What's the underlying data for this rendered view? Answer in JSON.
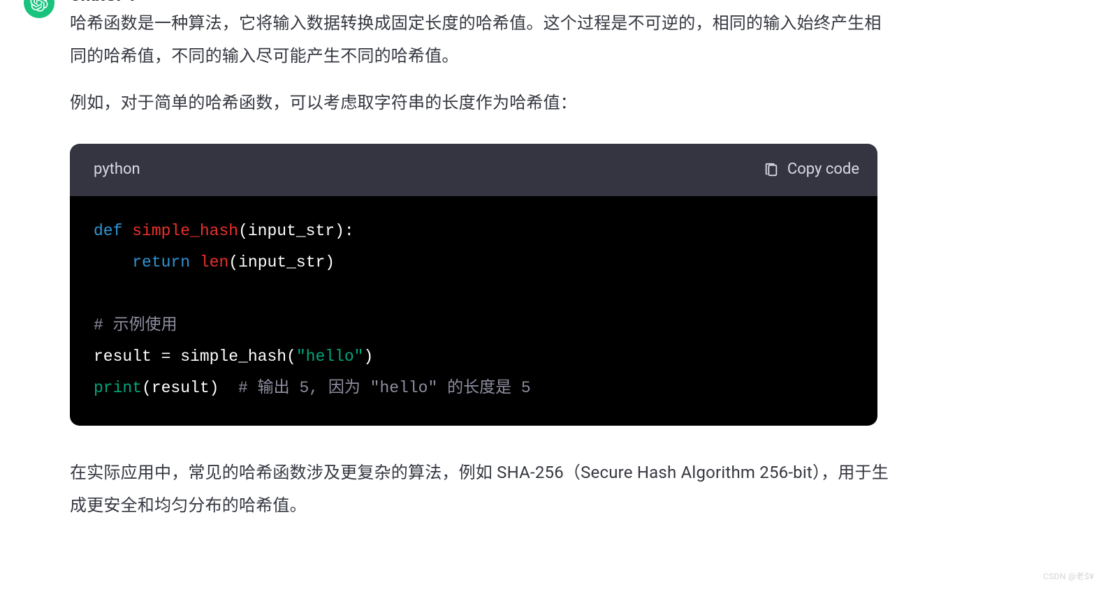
{
  "author": "ChatGPT",
  "paragraphs": {
    "p1": "哈希函数是一种算法，它将输入数据转换成固定长度的哈希值。这个过程是不可逆的，相同的输入始终产生相同的哈希值，不同的输入尽可能产生不同的哈希值。",
    "p2": "例如，对于简单的哈希函数，可以考虑取字符串的长度作为哈希值：",
    "p3": "在实际应用中，常见的哈希函数涉及更复杂的算法，例如 SHA-256（Secure Hash Algorithm 256-bit），用于生成更安全和均匀分布的哈希值。"
  },
  "code": {
    "language": "python",
    "copy_label": "Copy code",
    "tokens": {
      "kw_def": "def",
      "fn_name": "simple_hash",
      "sig_open": "(input_str):",
      "kw_return": "return",
      "builtin_len": "len",
      "len_args": "(input_str)",
      "cmt1": "# 示例使用",
      "line3a": "result = simple_hash(",
      "str_hello": "\"hello\"",
      "line3b": ")",
      "print": "print",
      "print_args": "(result)  ",
      "cmt2": "# 输出 5, 因为 \"hello\" 的长度是 5"
    }
  },
  "watermark": "CSDN @老$¥"
}
